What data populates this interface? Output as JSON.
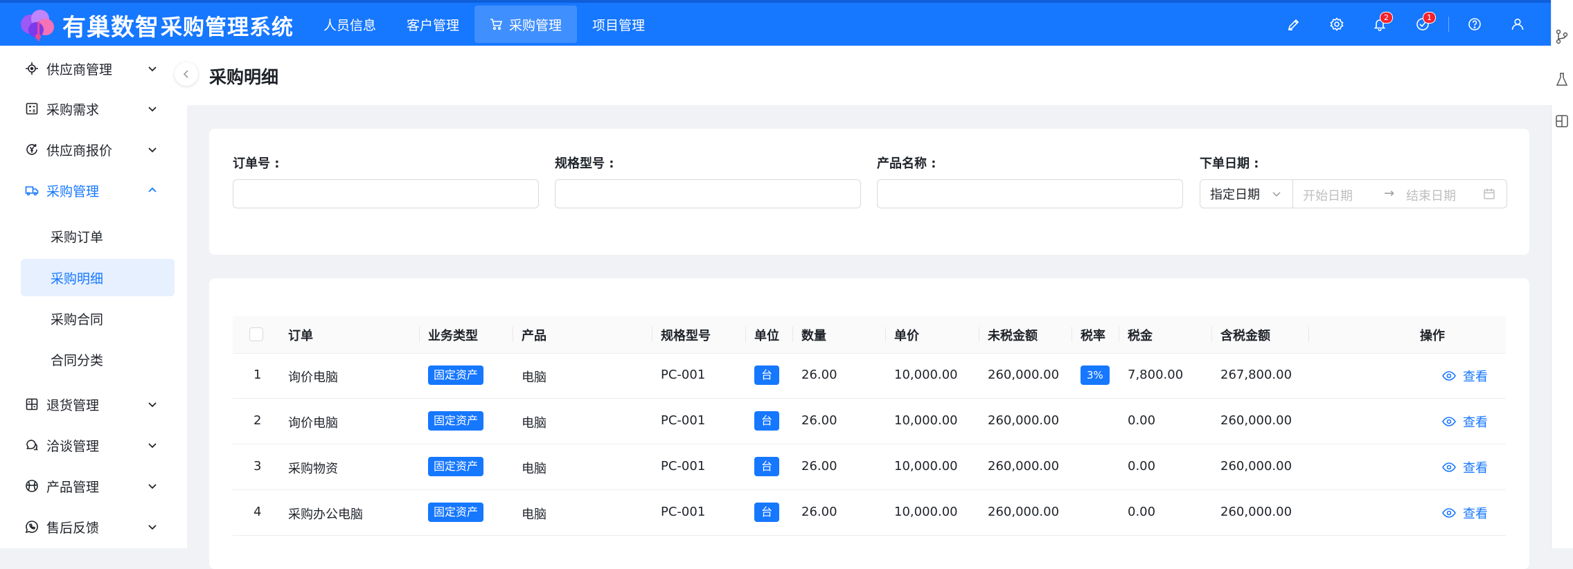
{
  "header": {
    "logo_text": "有巢数智",
    "app_title": "采购管理系统",
    "nav": [
      {
        "label": "人员信息"
      },
      {
        "label": "客户管理"
      },
      {
        "label": "采购管理"
      },
      {
        "label": "项目管理"
      }
    ],
    "notifications_count": "2",
    "tasks_count": "1",
    "brand_color": "#1677ff"
  },
  "sidebar": {
    "items": [
      {
        "label": "供应商管理"
      },
      {
        "label": "采购需求"
      },
      {
        "label": "供应商报价"
      },
      {
        "label": "采购管理"
      },
      {
        "label": "退货管理"
      },
      {
        "label": "洽谈管理"
      },
      {
        "label": "产品管理"
      },
      {
        "label": "售后反馈"
      }
    ],
    "sub_items": [
      {
        "label": "采购订单"
      },
      {
        "label": "采购明细"
      },
      {
        "label": "采购合同"
      },
      {
        "label": "合同分类"
      }
    ]
  },
  "page": {
    "title": "采购明细"
  },
  "filters": {
    "order_no": "订单号 :",
    "spec": "规格型号 :",
    "product_name": "产品名称 :",
    "order_date": "下单日期 :",
    "date_type": "指定日期",
    "start_placeholder": "开始日期",
    "end_placeholder": "结束日期",
    "range_separator": "→"
  },
  "table": {
    "columns": {
      "order": "订单",
      "biz_type": "业务类型",
      "product": "产品",
      "spec": "规格型号",
      "unit": "单位",
      "qty": "数量",
      "price": "单价",
      "pre_tax": "未税金额",
      "tax_rate": "税率",
      "tax": "税金",
      "total": "含税金额",
      "action": "操作"
    },
    "rows": [
      {
        "index": "1",
        "order": "询价电脑",
        "biz_type": "固定资产",
        "product": "电脑",
        "spec": "PC-001",
        "unit": "台",
        "qty": "26.00",
        "price": "10,000.00",
        "pre_tax": "260,000.00",
        "tax_rate": "3%",
        "tax": "7,800.00",
        "total": "267,800.00",
        "action": "查看"
      },
      {
        "index": "2",
        "order": "询价电脑",
        "biz_type": "固定资产",
        "product": "电脑",
        "spec": "PC-001",
        "unit": "台",
        "qty": "26.00",
        "price": "10,000.00",
        "pre_tax": "260,000.00",
        "tax_rate": "",
        "tax": "0.00",
        "total": "260,000.00",
        "action": "查看"
      },
      {
        "index": "3",
        "order": "采购物资",
        "biz_type": "固定资产",
        "product": "电脑",
        "spec": "PC-001",
        "unit": "台",
        "qty": "26.00",
        "price": "10,000.00",
        "pre_tax": "260,000.00",
        "tax_rate": "",
        "tax": "0.00",
        "total": "260,000.00",
        "action": "查看"
      },
      {
        "index": "4",
        "order": "采购办公电脑",
        "biz_type": "固定资产",
        "product": "电脑",
        "spec": "PC-001",
        "unit": "台",
        "qty": "26.00",
        "price": "10,000.00",
        "pre_tax": "260,000.00",
        "tax_rate": "",
        "tax": "0.00",
        "total": "260,000.00",
        "action": "查看"
      }
    ]
  }
}
